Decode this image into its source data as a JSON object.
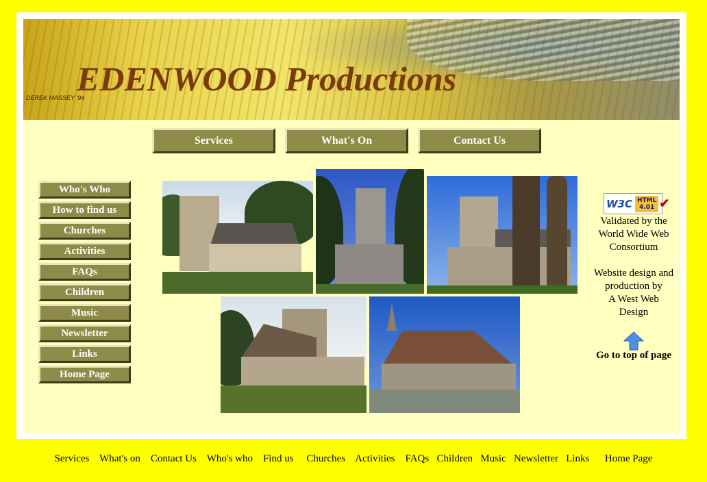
{
  "banner": {
    "title": "EDENWOOD Productions",
    "artist_signature": "DEREK MASSEY '94"
  },
  "top_nav": [
    {
      "label": "Services"
    },
    {
      "label": "What's On"
    },
    {
      "label": "Contact Us"
    }
  ],
  "side_nav": [
    {
      "label": "Who's Who"
    },
    {
      "label": "How to find us"
    },
    {
      "label": "Churches"
    },
    {
      "label": "Activities"
    },
    {
      "label": "FAQs"
    },
    {
      "label": "Children"
    },
    {
      "label": "Music"
    },
    {
      "label": "Newsletter"
    },
    {
      "label": "Links"
    },
    {
      "label": "Home Page"
    }
  ],
  "badge": {
    "w3c": "W3C",
    "html_label": "HTML",
    "html_version": "4.01"
  },
  "right_panel": {
    "validated_line1": "Validated by the",
    "validated_line2": "World Wide Web",
    "validated_line3": "Consortium",
    "design_line1": "Website design and",
    "design_line2": "production by",
    "design_line3": "A West Web",
    "design_line4": "Design",
    "go_to_top": "Go to top of page"
  },
  "footer_links": [
    {
      "label": "Services"
    },
    {
      "label": "What's on"
    },
    {
      "label": "Contact Us"
    },
    {
      "label": "Who's who"
    },
    {
      "label": "Find us"
    },
    {
      "label": "Churches"
    },
    {
      "label": "Activities"
    },
    {
      "label": "FAQs"
    },
    {
      "label": "Children"
    },
    {
      "label": "Music"
    },
    {
      "label": "Newsletter"
    },
    {
      "label": "Links"
    },
    {
      "label": "Home Page"
    }
  ],
  "colors": {
    "page_background": "#ffff00",
    "content_background": "#ffffc0",
    "button_background": "#8e8a48",
    "title_color": "#7a3a0a"
  }
}
